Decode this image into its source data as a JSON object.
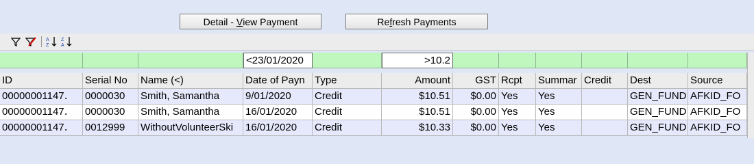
{
  "buttons": {
    "detail_prefix": "Detail - ",
    "detail_mnemonic": "V",
    "detail_suffix": "iew Payment",
    "refresh_prefix": "Re",
    "refresh_mnemonic": "f",
    "refresh_suffix": "resh Payments"
  },
  "toolbar": {
    "icons": [
      "filter-icon",
      "clear-filter-icon",
      "sort-ascending-icon",
      "sort-descending-icon"
    ]
  },
  "filters": {
    "date": "<23/01/2020",
    "amount": ">10.2"
  },
  "columns": [
    "ID",
    "Serial No",
    "Name (<)",
    "Date of Payn",
    "Type",
    "Amount",
    "GST",
    "Rcpt",
    "Summar",
    "Credit",
    "Dest",
    "Source"
  ],
  "rows": [
    [
      "00000001147․",
      "0000030",
      "Smith, Samantha",
      "9/01/2020",
      "Credit",
      "$10.51",
      "$0.00",
      "Yes",
      "Yes",
      "",
      "GEN_FUND",
      "AFKID_FO"
    ],
    [
      "00000001147․",
      "0000030",
      "Smith, Samantha",
      "16/01/2020",
      "Credit",
      "$10.51",
      "$0.00",
      "Yes",
      "Yes",
      "",
      "GEN_FUND",
      "AFKID_FO"
    ],
    [
      "00000001147․",
      "0012999",
      "WithoutVolunteerSki",
      "16/01/2020",
      "Credit",
      "$10.33",
      "$0.00",
      "Yes",
      "Yes",
      "",
      "GEN_FUND",
      "AFKID_FO"
    ]
  ],
  "colors": {
    "filter_row": "#bff7bf",
    "alt_row": "#e6e9fb",
    "background": "#dfe6f5"
  }
}
